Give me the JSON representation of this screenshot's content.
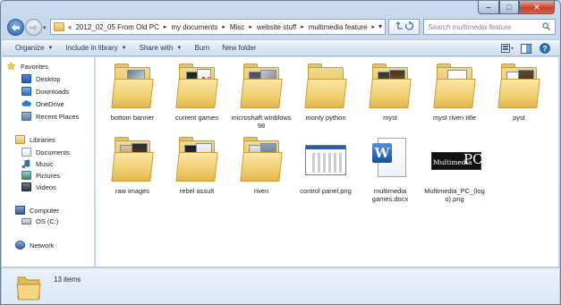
{
  "window": {
    "minimize_glyph": "–",
    "maximize_glyph": "□",
    "close_glyph": "✕"
  },
  "address": {
    "prefix": "«",
    "crumbs": [
      "2012_02_05 From Old PC",
      "my documents",
      "Misc",
      "website stuff",
      "multimedia feature"
    ]
  },
  "search": {
    "placeholder": "Search multimedia feature"
  },
  "toolbar": {
    "organize": "Organize",
    "include": "Include in library",
    "share": "Share with",
    "burn": "Burn",
    "new_folder": "New folder"
  },
  "nav": {
    "favorites": "Favorites",
    "desktop": "Desktop",
    "downloads": "Downloads",
    "onedrive": "OneDrive",
    "recent": "Recent Places",
    "libraries": "Libraries",
    "documents": "Documents",
    "music": "Music",
    "pictures": "Pictures",
    "videos": "Videos",
    "computer": "Computer",
    "osc": "OS (C:)",
    "network": "Network"
  },
  "items": [
    {
      "label": "bottom banner",
      "kind": "folder"
    },
    {
      "label": "current games",
      "kind": "folder"
    },
    {
      "label": "microshaft winblows 98",
      "kind": "folder"
    },
    {
      "label": "monty python",
      "kind": "folder"
    },
    {
      "label": "myst",
      "kind": "folder"
    },
    {
      "label": "myst riven title",
      "kind": "folder"
    },
    {
      "label": "pyst",
      "kind": "folder"
    },
    {
      "label": "raw images",
      "kind": "folder"
    },
    {
      "label": "rebel assult",
      "kind": "folder"
    },
    {
      "label": "riven",
      "kind": "folder"
    },
    {
      "label": "control panel.png",
      "kind": "png"
    },
    {
      "label": "multimedia games.docx",
      "kind": "docx"
    },
    {
      "label": "Multimedia_PC_(logo).png",
      "kind": "png-logo"
    }
  ],
  "logo": {
    "text1": "Multimedia",
    "text2": "PC"
  },
  "status": {
    "count": "13 items"
  }
}
